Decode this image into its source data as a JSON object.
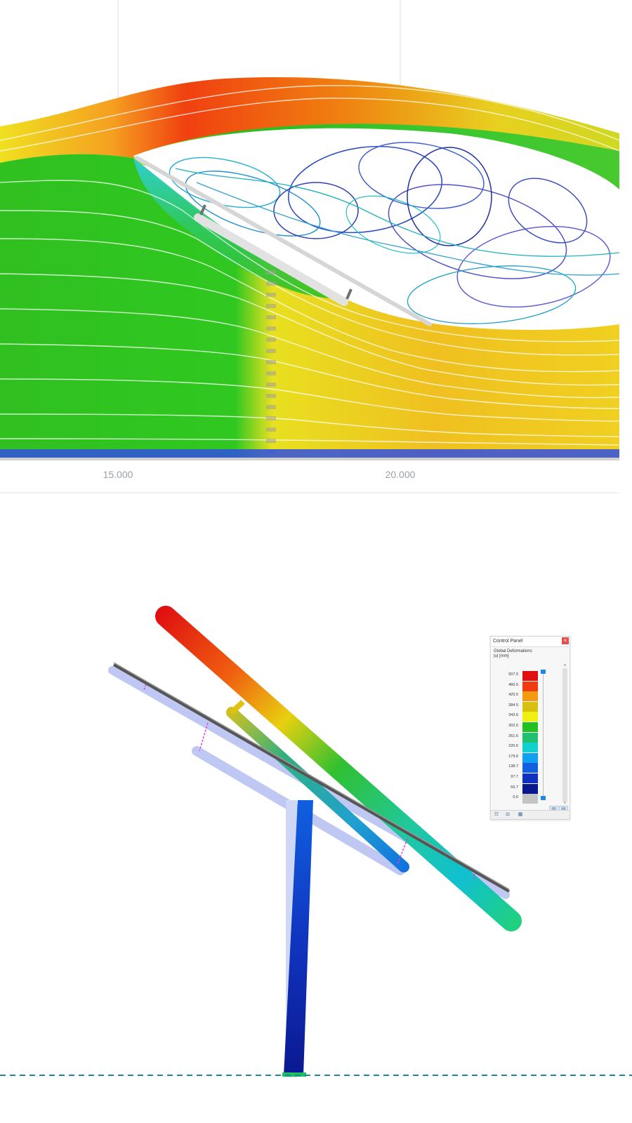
{
  "cfd_view": {
    "axis_ticks": [
      "15.000",
      "20.000"
    ]
  },
  "control_panel": {
    "title": "Control Panel",
    "close_symbol": "×",
    "result_type": "Global Deformations",
    "unit": "|u| [mm]",
    "scale": [
      {
        "value": "507.0",
        "color": "#e01010"
      },
      {
        "value": "466.5",
        "color": "#f03a10"
      },
      {
        "value": "425.5",
        "color": "#f29a10"
      },
      {
        "value": "384.5",
        "color": "#d8c010"
      },
      {
        "value": "343.6",
        "color": "#f0f010"
      },
      {
        "value": "302.6",
        "color": "#22c020"
      },
      {
        "value": "261.6",
        "color": "#20c070"
      },
      {
        "value": "220.6",
        "color": "#10d0d0"
      },
      {
        "value": "179.6",
        "color": "#10a0f0"
      },
      {
        "value": "138.7",
        "color": "#1060e0"
      },
      {
        "value": "97.7",
        "color": "#1030c0"
      },
      {
        "value": "56.7",
        "color": "#0a1890"
      },
      {
        "value": "0.0",
        "color": "#c4c4c4"
      }
    ],
    "scroll_up": "˄",
    "scroll_down": "˅",
    "tool_icons": [
      "list-tree-icon",
      "balance-icon",
      "chart-icon"
    ],
    "right_tool_icons": [
      "bar-chart-icon",
      "legend-icon"
    ]
  }
}
